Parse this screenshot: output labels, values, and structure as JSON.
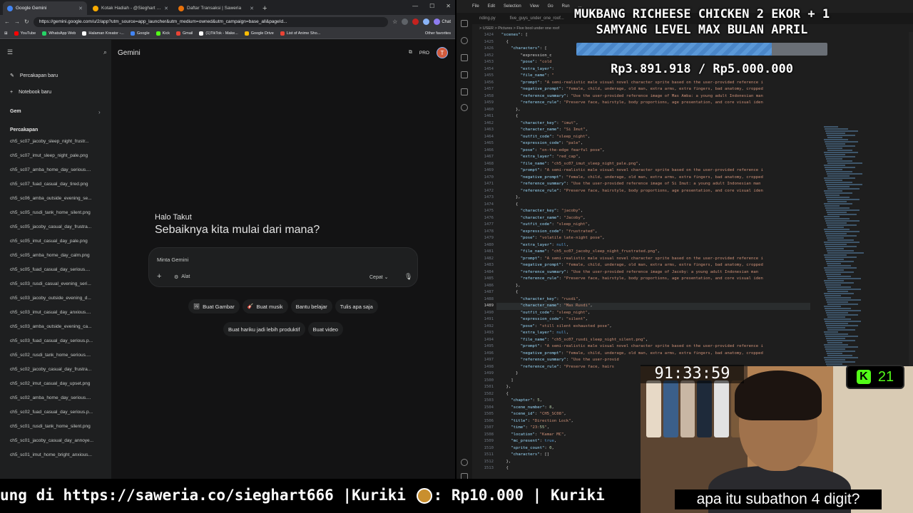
{
  "browser": {
    "tabs": [
      {
        "title": "Google Gemini",
        "active": true,
        "color": "#4285f4"
      },
      {
        "title": "Kotak Hadiah - @Sieghart | Tako",
        "active": false,
        "color": "#f9ab00"
      },
      {
        "title": "Daftar Transaksi | Saweria",
        "active": false,
        "color": "#e8710a"
      }
    ],
    "url": "https://gemini.google.com/u/2/app?utm_source=app_launcher&utm_medium=owned&utm_campaign=base_all&pageId...",
    "chat_label": "Chat",
    "bookmarks": [
      {
        "label": "YouTube",
        "color": "#ff0000"
      },
      {
        "label": "WhatsApp Web",
        "color": "#25d366"
      },
      {
        "label": "Halaman Kreator -...",
        "color": "#ffffff"
      },
      {
        "label": "Google",
        "color": "#4285f4"
      },
      {
        "label": "Kick",
        "color": "#53fc18"
      },
      {
        "label": "Gmail",
        "color": "#ea4335"
      },
      {
        "label": "(1)TikTok - Make...",
        "color": "#ffffff"
      },
      {
        "label": "Google Drive",
        "color": "#fbbc04"
      },
      {
        "label": "List of Anime Sho...",
        "color": "#ea4335"
      }
    ],
    "other_favorites": "Other favorites"
  },
  "gemini": {
    "sidebar": {
      "new_chat": "Percakapan baru",
      "notebook": "Notebook baru",
      "gem": "Gem",
      "section": "Percakapan",
      "items": [
        "ch5_sc07_jacoby_sleep_night_frustr...",
        "ch5_sc07_imut_sleep_night_pale.png",
        "ch5_sc07_amba_home_day_serious....",
        "ch5_sc07_fuad_casual_day_tired.png",
        "ch5_sc06_amba_outside_evening_se...",
        "ch5_sc05_rusdi_tank_home_silent.png",
        "ch5_sc05_jacoby_casual_day_frustra...",
        "ch5_sc05_imut_casual_day_pale.png",
        "ch5_sc05_amba_home_day_calm.png",
        "ch5_sc05_fuad_casual_day_serious....",
        "ch5_sc03_rusdi_casual_evening_seri...",
        "ch5_sc03_jacoby_outside_evening_d...",
        "ch5_sc03_imut_casual_day_anxious....",
        "ch5_sc03_amba_outside_evening_ca...",
        "ch5_sc03_fuad_casual_day_serious.p...",
        "ch5_sc02_rusdi_tank_home_serious....",
        "ch5_sc02_jacoby_casual_day_frustra...",
        "ch5_sc02_imut_casual_day_upset.png",
        "ch5_sc02_amba_home_day_serious....",
        "ch5_sc02_fuad_casual_day_serious.p...",
        "ch5_sc01_rusdi_tank_home_silent.png",
        "ch5_sc01_jacoby_casual_day_annoye...",
        "ch5_sc01_imut_home_bright_anxious..."
      ]
    },
    "brand": "Gemini",
    "pro_label": "PRO",
    "avatar_initial": "T",
    "greeting": "Halo Takut",
    "question": "Sebaiknya kita mulai dari mana?",
    "prompt_placeholder": "Minta Gemini",
    "tools_label": "Alat",
    "mode_label": "Cepat",
    "chips_row1": [
      "Buat Gambar",
      "Buat musik",
      "Bantu belajar",
      "Tulis apa saja"
    ],
    "chips_row2": [
      "Buat hariku jadi lebih produktif",
      "Buat video"
    ]
  },
  "vscode": {
    "menu": [
      "File",
      "Edit",
      "Selection",
      "View",
      "Go",
      "Run",
      "..."
    ],
    "tabs": [
      "nding.py",
      "five_guys_under_one_roof..."
    ],
    "breadcrumb": "> USER > Pictures > Five bool under one roof",
    "lines": [
      {
        "n": "1424",
        "t": "  \"scenes\": ["
      },
      {
        "n": "1425",
        "t": "    {"
      },
      {
        "n": "1426",
        "t": "      \"characters\": ["
      },
      {
        "n": "1452",
        "t": "          \"expression_c"
      },
      {
        "n": "1453",
        "t": "          \"pose\": \"cold"
      },
      {
        "n": "1454",
        "t": "          \"extra_layer\":"
      },
      {
        "n": "1455",
        "t": "          \"file_name\": \""
      },
      {
        "n": "1456",
        "t": "          \"prompt\": \"A semi-realistic male visual novel character sprite based on the user-provided reference i"
      },
      {
        "n": "1457",
        "t": "          \"negative_prompt\": \"female, child, underage, old man, extra arms, extra fingers, bad anatomy, cropped"
      },
      {
        "n": "1458",
        "t": "          \"reference_summary\": \"Use the user-provided reference image of Mas Amba: a young adult Indonesian man"
      },
      {
        "n": "1459",
        "t": "          \"reference_rule\": \"Preserve face, hairstyle, body proportions, age presentation, and core visual iden"
      },
      {
        "n": "1460",
        "t": "        },"
      },
      {
        "n": "1461",
        "t": "        {"
      },
      {
        "n": "1462",
        "t": "          \"character_key\": \"imut\","
      },
      {
        "n": "1463",
        "t": "          \"character_name\": \"Si Imut\","
      },
      {
        "n": "1464",
        "t": "          \"outfit_code\": \"sleep_night\","
      },
      {
        "n": "1465",
        "t": "          \"expression_code\": \"pale\","
      },
      {
        "n": "1466",
        "t": "          \"pose\": \"on-the-edge fearful pose\","
      },
      {
        "n": "1467",
        "t": "          \"extra_layer\": \"red_cap\","
      },
      {
        "n": "1468",
        "t": "          \"file_name\": \"ch5_sc07_imut_sleep_night_pale.png\","
      },
      {
        "n": "1469",
        "t": "          \"prompt\": \"A semi-realistic male visual novel character sprite based on the user-provided reference i"
      },
      {
        "n": "1470",
        "t": "          \"negative_prompt\": \"female, child, underage, old man, extra arms, extra fingers, bad anatomy, cropped"
      },
      {
        "n": "1471",
        "t": "          \"reference_summary\": \"Use the user-provided reference image of Si Imut: a young adult Indonesian man"
      },
      {
        "n": "1472",
        "t": "          \"reference_rule\": \"Preserve face, hairstyle, body proportions, age presentation, and core visual iden"
      },
      {
        "n": "1473",
        "t": "        },"
      },
      {
        "n": "1474",
        "t": "        {"
      },
      {
        "n": "1475",
        "t": "          \"character_key\": \"jacoby\","
      },
      {
        "n": "1476",
        "t": "          \"character_name\": \"Jacoby\","
      },
      {
        "n": "1477",
        "t": "          \"outfit_code\": \"sleep_night\","
      },
      {
        "n": "1478",
        "t": "          \"expression_code\": \"frustrated\","
      },
      {
        "n": "1479",
        "t": "          \"pose\": \"volatile late-night pose\","
      },
      {
        "n": "1480",
        "t": "          \"extra_layer\": null,"
      },
      {
        "n": "1481",
        "t": "          \"file_name\": \"ch5_sc07_jacoby_sleep_night_frustrated.png\","
      },
      {
        "n": "1482",
        "t": "          \"prompt\": \"A semi-realistic male visual novel character sprite based on the user-provided reference i"
      },
      {
        "n": "1483",
        "t": "          \"negative_prompt\": \"female, child, underage, old man, extra arms, extra fingers, bad anatomy, cropped"
      },
      {
        "n": "1484",
        "t": "          \"reference_summary\": \"Use the user-provided reference image of Jacoby: a young adult Indonesian man"
      },
      {
        "n": "1485",
        "t": "          \"reference_rule\": \"Preserve face, hairstyle, body proportions, age presentation, and core visual iden"
      },
      {
        "n": "1486",
        "t": "        },"
      },
      {
        "n": "1487",
        "t": "        {"
      },
      {
        "n": "1488",
        "t": "          \"character_key\": \"rusdi\","
      },
      {
        "n": "1489",
        "t": "          \"character_name\": \"Mas Rusdi\",",
        "cur": true
      },
      {
        "n": "1490",
        "t": "          \"outfit_code\": \"sleep_night\","
      },
      {
        "n": "1491",
        "t": "          \"expression_code\": \"silent\","
      },
      {
        "n": "1492",
        "t": "          \"pose\": \"still silent exhausted pose\","
      },
      {
        "n": "1493",
        "t": "          \"extra_layer\": null,"
      },
      {
        "n": "1494",
        "t": "          \"file_name\": \"ch5_sc07_rusdi_sleep_night_silent.png\","
      },
      {
        "n": "1495",
        "t": "          \"prompt\": \"A semi-realistic male visual novel character sprite based on the user-provided reference i"
      },
      {
        "n": "1496",
        "t": "          \"negative_prompt\": \"female, child, underage, old man, extra arms, extra fingers, bad anatomy, cropped"
      },
      {
        "n": "1497",
        "t": "          \"reference_summary\": \"Use the user-provid"
      },
      {
        "n": "1498",
        "t": "          \"reference_rule\": \"Preserve face, hairs"
      },
      {
        "n": "1499",
        "t": "        }"
      },
      {
        "n": "1500",
        "t": "      ]"
      },
      {
        "n": "1501",
        "t": "    },"
      },
      {
        "n": "1502",
        "t": "    {"
      },
      {
        "n": "1503",
        "t": "      \"chapter\": 5,"
      },
      {
        "n": "1504",
        "t": "      \"scene_number\": 8,"
      },
      {
        "n": "1505",
        "t": "      \"scene_id\": \"CH5_SC08\","
      },
      {
        "n": "1506",
        "t": "      \"title\": \"Direction Lock\","
      },
      {
        "n": "1507",
        "t": "      \"time\": \"23:55\","
      },
      {
        "n": "1508",
        "t": "      \"location\": \"Kamar MC\","
      },
      {
        "n": "1509",
        "t": "      \"mc_present\": true,"
      },
      {
        "n": "1510",
        "t": "      \"sprite_count\": 0,"
      },
      {
        "n": "1511",
        "t": "      \"characters\": []"
      },
      {
        "n": "1512",
        "t": "    },"
      },
      {
        "n": "1513",
        "t": "    {"
      }
    ]
  },
  "goal": {
    "title_line1": "MUKBANG RICHEESE CHICKEN 2 EKOR + 1",
    "title_line2": "SAMYANG LEVEL MAX BULAN APRIL",
    "amount": "Rp3.891.918 / Rp5.000.000",
    "progress": 0.778,
    "bar_color": "#4a86c8"
  },
  "stream": {
    "timer": "91:33:59",
    "kick_count": "21",
    "kick_color": "#53fc18",
    "caption": "apa itu subathon 4 digit?",
    "ticker_part1": "ung di https://saweria.co/sieghart666 |Kuriki ",
    "ticker_part2": ": Rp10.000 | Kuriki"
  }
}
